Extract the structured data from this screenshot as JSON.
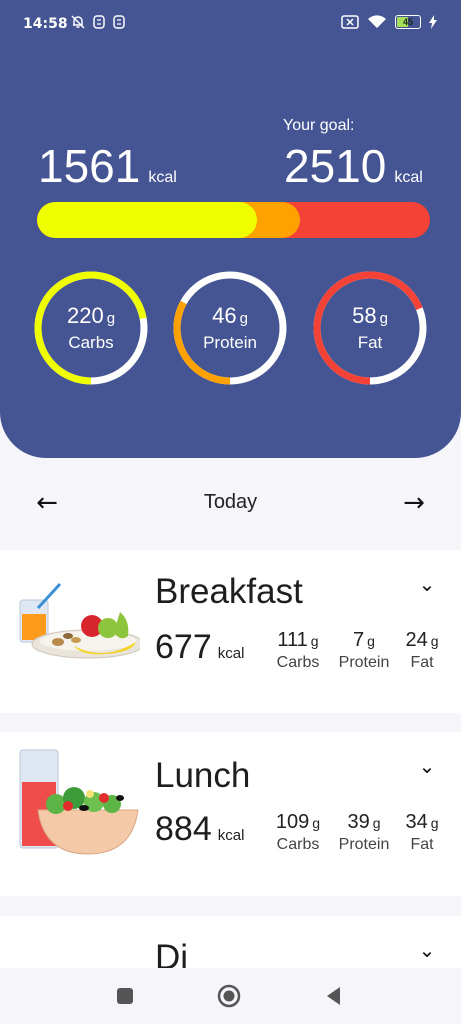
{
  "status": {
    "time": "14:58",
    "battery": "45"
  },
  "summary": {
    "consumed_value": "1561",
    "consumed_unit": "kcal",
    "goal_caption": "Your goal:",
    "goal_value": "2510",
    "goal_unit": "kcal",
    "progress_fraction_yellow": 0.56,
    "progress_fraction_orange": 0.67
  },
  "macros": [
    {
      "value": "220",
      "unit": "g",
      "label": "Carbs",
      "fraction": 0.72,
      "color": "#f0ff00"
    },
    {
      "value": "46",
      "unit": "g",
      "label": "Protein",
      "fraction": 0.33,
      "color": "#ffa200"
    },
    {
      "value": "58",
      "unit": "g",
      "label": "Fat",
      "fraction": 0.69,
      "color": "#f44336"
    }
  ],
  "daynav": {
    "label": "Today"
  },
  "meals": [
    {
      "title": "Breakfast",
      "kcal": "677",
      "kcal_unit": "kcal",
      "carbs": "111",
      "protein": "7",
      "fat": "24",
      "unit": "g",
      "carbs_label": "Carbs",
      "protein_label": "Protein",
      "fat_label": "Fat"
    },
    {
      "title": "Lunch",
      "kcal": "884",
      "kcal_unit": "kcal",
      "carbs": "109",
      "protein": "39",
      "fat": "34",
      "unit": "g",
      "carbs_label": "Carbs",
      "protein_label": "Protein",
      "fat_label": "Fat"
    },
    {
      "title": "Di"
    }
  ],
  "colors": {
    "header_bg": "#455492",
    "yellow": "#f0ff00",
    "orange": "#ffa200",
    "red": "#f44336"
  }
}
